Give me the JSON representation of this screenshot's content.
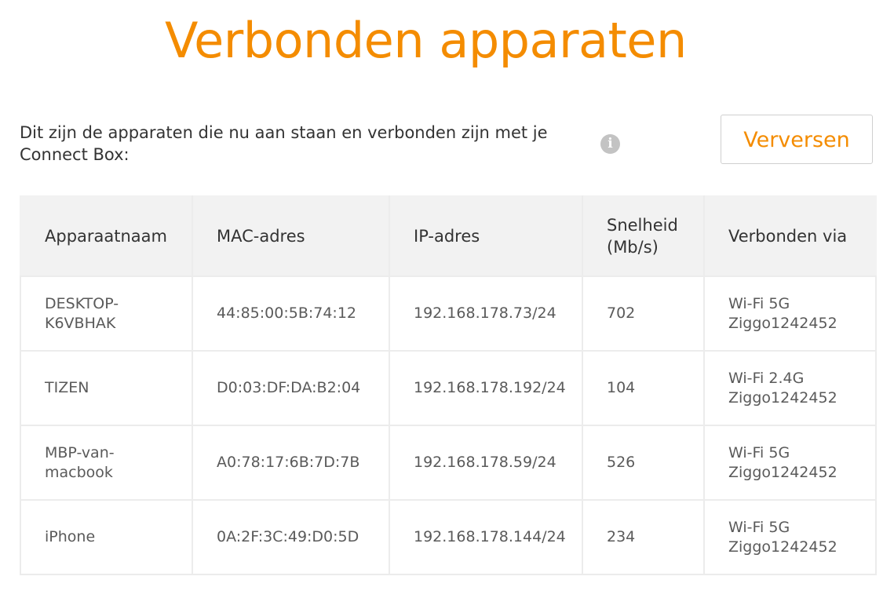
{
  "page": {
    "title": "Verbonden apparaten",
    "intro": "Dit zijn de apparaten die nu aan staan en verbonden zijn met je Connect Box:",
    "refresh_label": "Verversen",
    "info_icon": "info-icon",
    "accent_color": "#f48c00"
  },
  "table": {
    "headers": {
      "name": "Apparaatnaam",
      "mac": "MAC-adres",
      "ip": "IP-adres",
      "speed": "Snelheid (Mb/s)",
      "via": "Verbonden via"
    },
    "rows": [
      {
        "name": "DESKTOP-K6VBHAK",
        "mac": "44:85:00:5B:74:12",
        "ip": "192.168.178.73/24",
        "speed": "702",
        "via_band": "Wi-Fi 5G",
        "via_network": "Ziggo1242452"
      },
      {
        "name": "TIZEN",
        "mac": "D0:03:DF:DA:B2:04",
        "ip": "192.168.178.192/24",
        "speed": "104",
        "via_band": "Wi-Fi 2.4G",
        "via_network": "Ziggo1242452"
      },
      {
        "name": "MBP-van-macbook",
        "mac": "A0:78:17:6B:7D:7B",
        "ip": "192.168.178.59/24",
        "speed": "526",
        "via_band": "Wi-Fi 5G",
        "via_network": "Ziggo1242452"
      },
      {
        "name": "iPhone",
        "mac": "0A:2F:3C:49:D0:5D",
        "ip": "192.168.178.144/24",
        "speed": "234",
        "via_band": "Wi-Fi 5G",
        "via_network": "Ziggo1242452"
      }
    ]
  }
}
